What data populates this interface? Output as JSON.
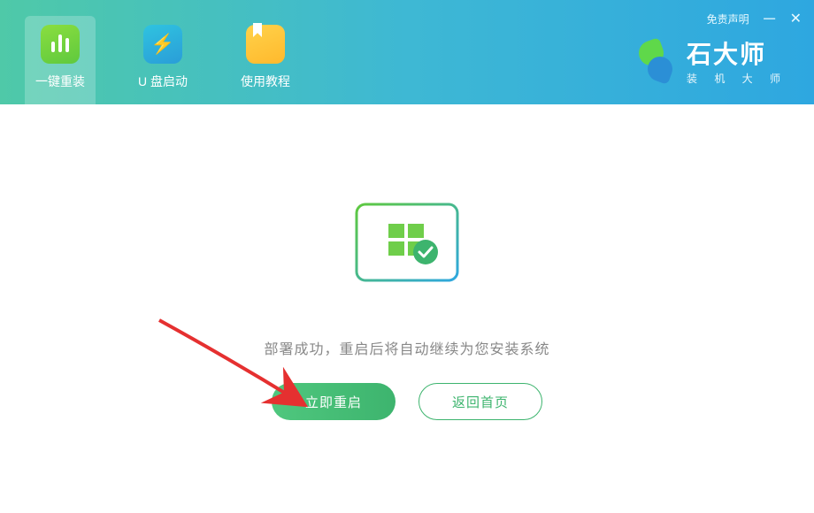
{
  "header": {
    "tabs": [
      {
        "label": "一键重装"
      },
      {
        "label": "U 盘启动"
      },
      {
        "label": "使用教程"
      }
    ],
    "disclaimer": "免责声明",
    "brand": {
      "name": "石大师",
      "tagline": "装 机 大 师"
    }
  },
  "main": {
    "status_text": "部署成功，重启后将自动继续为您安装系统",
    "restart_label": "立即重启",
    "home_label": "返回首页"
  }
}
